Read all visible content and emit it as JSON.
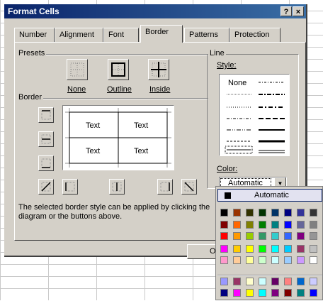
{
  "dialog": {
    "title": "Format Cells",
    "help_label": "?",
    "close_label": "×"
  },
  "tabs": [
    {
      "label": "Number"
    },
    {
      "label": "Alignment"
    },
    {
      "label": "Font"
    },
    {
      "label": "Border",
      "active": true
    },
    {
      "label": "Patterns"
    },
    {
      "label": "Protection"
    }
  ],
  "presets": {
    "title": "Presets",
    "none_label": "None",
    "outline_label": "Outline",
    "inside_label": "Inside"
  },
  "border": {
    "title": "Border",
    "cells": [
      "Text",
      "Text",
      "Text",
      "Text"
    ]
  },
  "line": {
    "title": "Line",
    "style_label": "Style:",
    "none_label": "None",
    "color_label": "Color:",
    "color_value": "Automatic"
  },
  "hint": "The selected border style can be applied by clicking the diagram or the buttons above.",
  "ok_label": "OK",
  "palette": {
    "automatic_label": "Automatic",
    "rows": [
      [
        "#000000",
        "#993300",
        "#333300",
        "#003300",
        "#003366",
        "#000080",
        "#333399",
        "#333333"
      ],
      [
        "#800000",
        "#ff6600",
        "#808000",
        "#008000",
        "#008080",
        "#0000ff",
        "#666699",
        "#808080"
      ],
      [
        "#ff0000",
        "#ff9900",
        "#99cc00",
        "#339966",
        "#33cccc",
        "#3366ff",
        "#800080",
        "#969696"
      ],
      [
        "#ff00ff",
        "#ffcc00",
        "#ffff00",
        "#00ff00",
        "#00ffff",
        "#00ccff",
        "#993366",
        "#c0c0c0"
      ],
      [
        "#ff99cc",
        "#ffcc99",
        "#ffff99",
        "#ccffcc",
        "#ccffff",
        "#99ccff",
        "#cc99ff",
        "#ffffff"
      ],
      [
        "#9999ff",
        "#993366",
        "#ffffcc",
        "#ccffff",
        "#660066",
        "#ff8080",
        "#0066cc",
        "#ccccff"
      ],
      [
        "#000080",
        "#ff00ff",
        "#ffff00",
        "#00ffff",
        "#800080",
        "#800000",
        "#008080",
        "#0000ff"
      ]
    ]
  }
}
